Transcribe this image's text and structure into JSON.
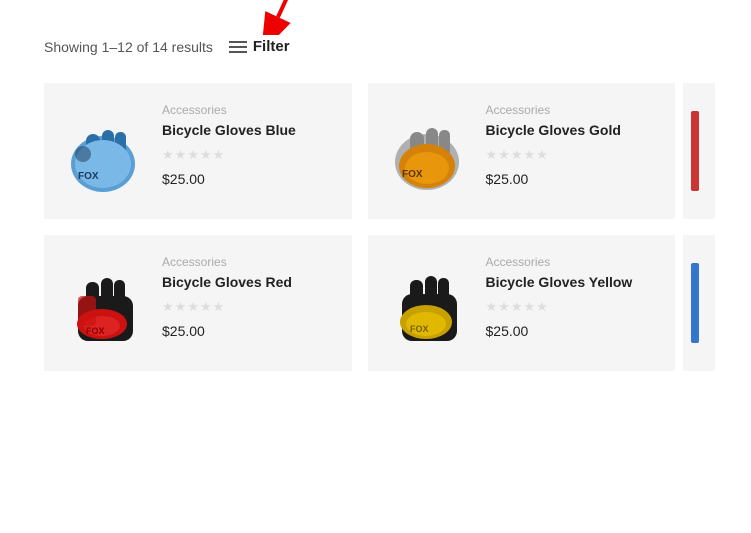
{
  "header": {
    "results_text": "Showing 1–12 of 14 results",
    "filter_label": "Filter"
  },
  "rows": [
    {
      "cards": [
        {
          "id": "card-blue",
          "category": "Accessories",
          "name": "Bicycle Gloves Blue",
          "price": "$25.00",
          "stars": 0,
          "glove_color": "blue"
        },
        {
          "id": "card-gold",
          "category": "Accessories",
          "name": "Bicycle Gloves Gold",
          "price": "$25.00",
          "stars": 0,
          "glove_color": "gold"
        }
      ],
      "partial_color": "red-partial"
    },
    {
      "cards": [
        {
          "id": "card-red",
          "category": "Accessories",
          "name": "Bicycle Gloves Red",
          "price": "$25.00",
          "stars": 0,
          "glove_color": "red"
        },
        {
          "id": "card-yellow",
          "category": "Accessories",
          "name": "Bicycle Gloves Yellow",
          "price": "$25.00",
          "stars": 0,
          "glove_color": "yellow"
        }
      ],
      "partial_color": "blue-partial"
    }
  ]
}
